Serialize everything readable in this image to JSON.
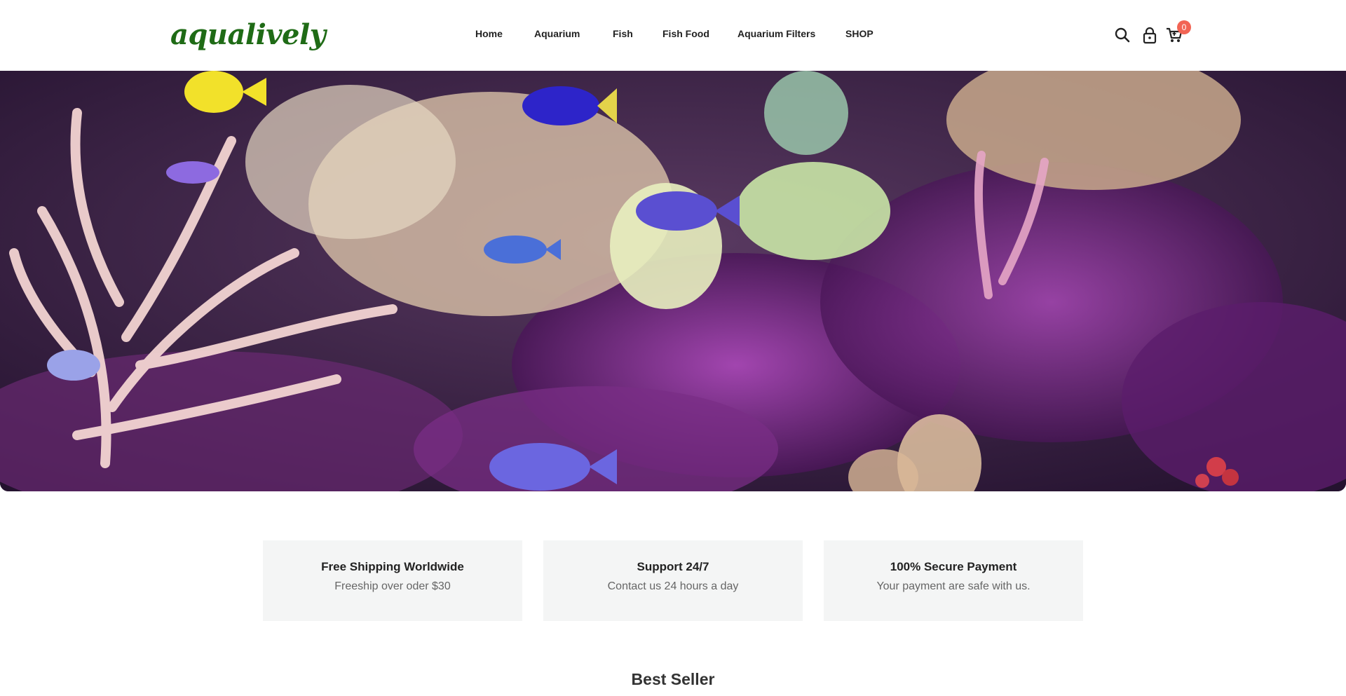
{
  "brand": {
    "name": "aqualively",
    "color": "#1f6b16"
  },
  "nav": {
    "items": [
      {
        "label": "Home"
      },
      {
        "label": "Aquarium"
      },
      {
        "label": "Fish"
      },
      {
        "label": "Fish Food"
      },
      {
        "label": "Aquarium Filters"
      },
      {
        "label": "SHOP"
      }
    ]
  },
  "header_icons": {
    "search": "search-icon",
    "account": "lock-icon",
    "cart": "cart-icon",
    "cart_count": "0",
    "badge_color": "#f26454"
  },
  "hero": {
    "image": "aquarium-reef-banner"
  },
  "features": [
    {
      "title": "Free Shipping Worldwide",
      "subtitle": "Freeship over oder $30"
    },
    {
      "title": "Support 24/7",
      "subtitle": "Contact us 24 hours a day"
    },
    {
      "title": "100% Secure Payment",
      "subtitle": "Your payment are safe with us."
    }
  ],
  "best_seller": {
    "title": "Best Seller"
  }
}
